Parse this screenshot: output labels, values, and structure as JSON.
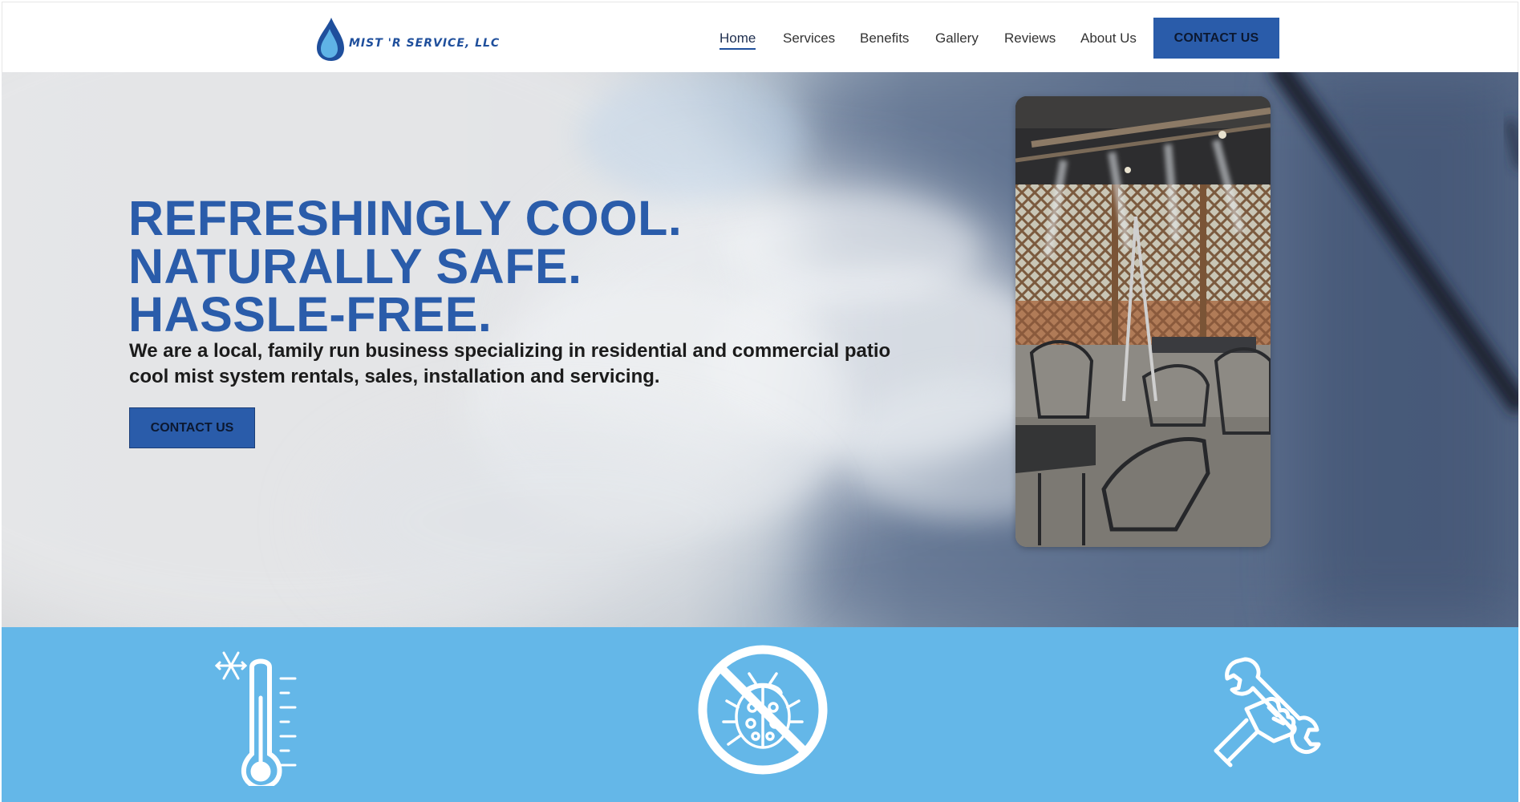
{
  "header": {
    "logo_text": "MIST 'R SERVICE, LLC",
    "nav": {
      "home": "Home",
      "services": "Services",
      "benefits": "Benefits",
      "gallery": "Gallery",
      "reviews": "Reviews",
      "about": "About Us"
    },
    "contact_label": "CONTACT US"
  },
  "hero": {
    "title_line1": "REFRESHINGLY COOL.",
    "title_line2": "NATURALLY SAFE.",
    "title_line3": "HASSLE-FREE.",
    "subtitle": "We are a local, family run business specializing in residential and commercial patio cool mist system rentals, sales, installation and servicing.",
    "contact_label": "CONTACT US"
  },
  "benefits": {
    "icons": [
      "thermometer-snowflake-icon",
      "no-bugs-icon",
      "wrench-hand-icon"
    ]
  },
  "colors": {
    "brand_blue": "#2a5caa",
    "strip_blue": "#64b7e8"
  }
}
